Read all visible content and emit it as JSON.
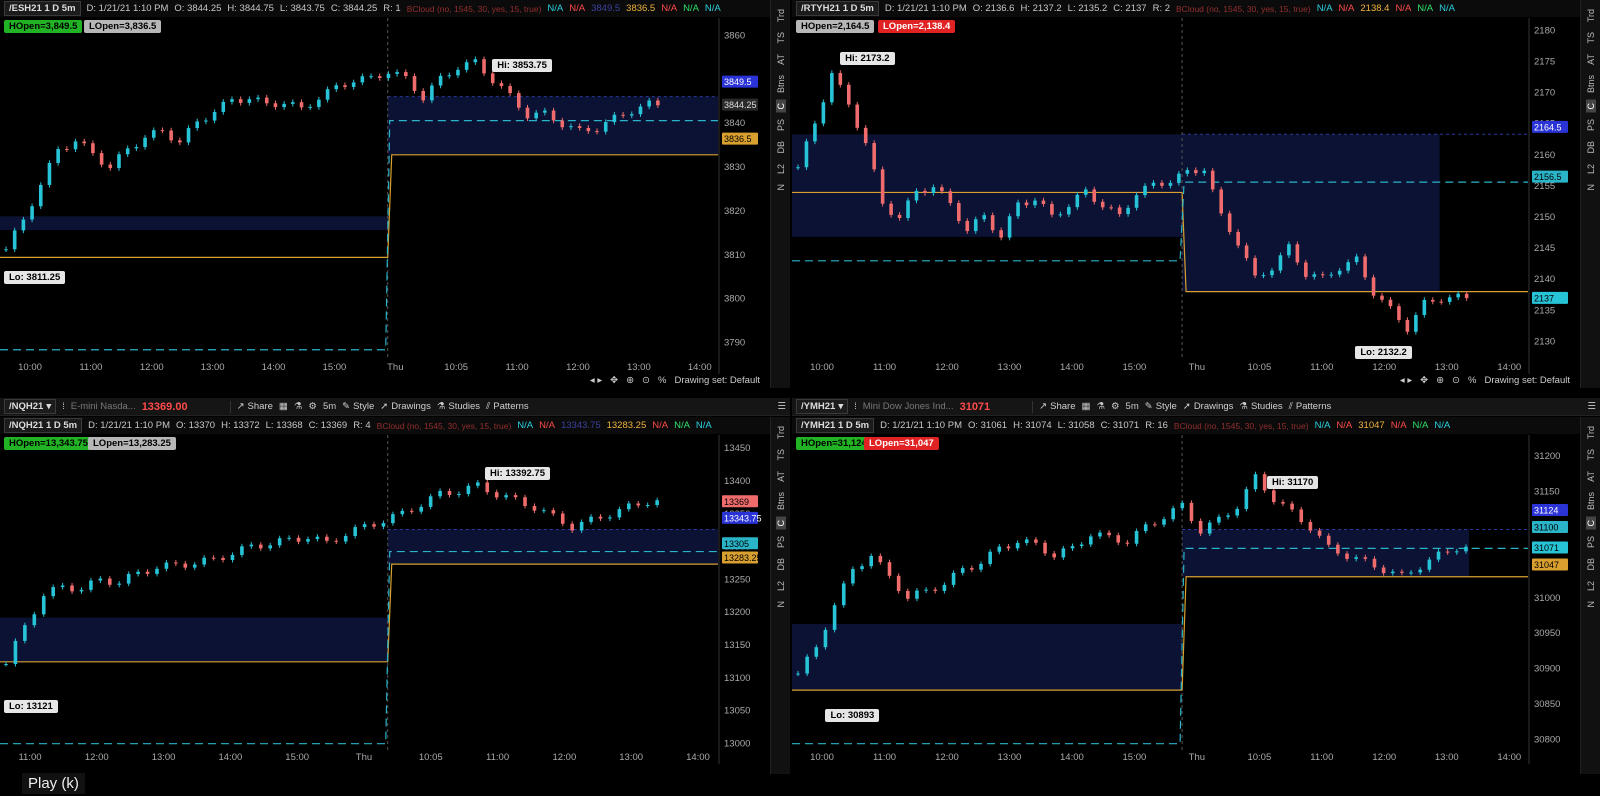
{
  "common": {
    "side_tabs": [
      "Trd",
      "TS",
      "AT",
      "Btns",
      "C",
      "PS",
      "DB",
      "L2",
      "N"
    ],
    "study_label": "BCloud (no, 1545, 30, yes, 15, true)",
    "na": "N/A",
    "interval": "5m",
    "share": "Share",
    "style": "Style",
    "drawings": "Drawings",
    "studies": "Studies",
    "patterns": "Patterns",
    "drawing_set": "Drawing set: Default",
    "play": "Play (k)",
    "colors": {
      "bull": "#27c3d6",
      "bear": "#f06c6c",
      "cloud": "#0b1233",
      "orange": "#d9a030",
      "cyan_dash": "#2ab4c8"
    }
  },
  "panels": [
    {
      "id": "es",
      "symbol": "/ESH21",
      "description": "",
      "last_price": "",
      "change1": "",
      "change2": "",
      "header": {
        "sym": "/ESH21 1 D 5m",
        "date": "D: 1/21/21 1:10 PM",
        "o": "O: 3844.25",
        "h": "H: 3844.75",
        "l": "L: 3843.75",
        "c": "C: 3844.25",
        "r": "R: 1",
        "val1": "3836.5",
        "hidden_val": "3849.5"
      },
      "hopen": "HOpen=3,849.5",
      "lopen": "LOpen=3,836.5",
      "hopen_color": "#22b324",
      "lopen_color": "#b7b7b7",
      "hi_label": "Hi: 3853.75",
      "lo_label": "Lo: 3811.25",
      "chart_data": {
        "type": "line",
        "y_ticks": [
          3860,
          3850,
          3840,
          3830,
          3820,
          3810,
          3800,
          3790
        ],
        "ylim": [
          3786,
          3864
        ],
        "x_ticks": [
          "10:00",
          "11:00",
          "12:00",
          "13:00",
          "14:00",
          "15:00",
          "Thu",
          "10:05",
          "11:00",
          "12:00",
          "13:00",
          "14:00"
        ],
        "series": [
          {
            "values": [
              3811.25,
              3818,
              3826,
              3834,
              3836,
              3833,
              3830,
              3834,
              3837,
              3838,
              3836,
              3840,
              3843,
              3845,
              3846,
              3844,
              3845,
              3843,
              3846,
              3848,
              3850,
              3850,
              3852,
              3850,
              3846,
              3850,
              3853,
              3853.75,
              3850,
              3846,
              3842,
              3842,
              3840,
              3838,
              3839,
              3841,
              3843,
              3844.25
            ]
          }
        ],
        "price_tags": [
          {
            "value": "3849.5",
            "bg": "#2a33d6",
            "fg": "#fff",
            "y": 3849.5
          },
          {
            "value": "3844.25",
            "bg": "#2a2a2a",
            "fg": "#ddd",
            "y": 3844.25
          },
          {
            "value": "3836.5",
            "bg": "#d9a030",
            "fg": "#000",
            "y": 3836.5
          }
        ]
      }
    },
    {
      "id": "rty",
      "symbol": "/RTYH21",
      "description": "",
      "last_price": "",
      "change1": "",
      "change2": "",
      "header": {
        "sym": "/RTYH21 1 D 5m",
        "date": "D: 1/21/21 1:10 PM",
        "o": "O: 2136.6",
        "h": "H: 2137.2",
        "l": "L: 2135.2",
        "c": "C: 2137",
        "r": "R: 2",
        "val1": "2138.4",
        "hidden_val": ""
      },
      "hopen": "HOpen=2,164.5",
      "lopen": "LOpen=2,138.4",
      "hopen_color": "#b7b7b7",
      "lopen_color": "#e02222",
      "hi_label": "Hi: 2173.2",
      "lo_label": "Lo: 2132.2",
      "chart_data": {
        "type": "line",
        "y_ticks": [
          2180,
          2175,
          2170,
          2165,
          2160,
          2155,
          2150,
          2145,
          2140,
          2135,
          2130
        ],
        "ylim": [
          2127,
          2182
        ],
        "x_ticks": [
          "10:00",
          "11:00",
          "12:00",
          "13:00",
          "14:00",
          "15:00",
          "Thu",
          "10:05",
          "11:00",
          "12:00",
          "13:00",
          "14:00"
        ],
        "series": [
          {
            "values": [
              2158,
              2165,
              2173.2,
              2168,
              2162,
              2152,
              2150,
              2154,
              2155,
              2152,
              2148,
              2150,
              2147,
              2152,
              2153,
              2150,
              2152,
              2154,
              2152,
              2150,
              2154,
              2155,
              2156,
              2157,
              2158,
              2150,
              2146,
              2140,
              2142,
              2145,
              2141,
              2140,
              2142,
              2143,
              2138,
              2135,
              2132.2,
              2136,
              2137,
              2137
            ]
          }
        ],
        "price_tags": [
          {
            "value": "2164.5",
            "bg": "#2a33d6",
            "fg": "#fff",
            "y": 2164.5
          },
          {
            "value": "2156.5",
            "bg": "#2ab4c8",
            "fg": "#000",
            "y": 2156.5
          },
          {
            "value": "2137",
            "bg": "#27c3d6",
            "fg": "#000",
            "y": 2137
          }
        ]
      }
    },
    {
      "id": "nq",
      "symbol": "/NQH21",
      "description": "E-mini Nasda...",
      "last_price": "13369.00",
      "change1": "",
      "change2": "",
      "header": {
        "sym": "/NQH21 1 D 5m",
        "date": "D: 1/21/21 1:10 PM",
        "o": "O: 13370",
        "h": "H: 13372",
        "l": "L: 13368",
        "c": "C: 13369",
        "r": "R: 4",
        "val1": "13283.25",
        "hidden_val": "13343.75"
      },
      "hopen": "HOpen=13,343.75",
      "lopen": "LOpen=13,283.25",
      "hopen_color": "#22b324",
      "lopen_color": "#b7b7b7",
      "hi_label": "Hi: 13392.75",
      "lo_label": "Lo: 13121",
      "chart_data": {
        "type": "line",
        "y_ticks": [
          13450,
          13400,
          13350,
          13300,
          13250,
          13200,
          13150,
          13100,
          13050,
          13000
        ],
        "ylim": [
          12990,
          13470
        ],
        "x_ticks": [
          "11:00",
          "12:00",
          "13:00",
          "14:00",
          "15:00",
          "Thu",
          "10:05",
          "11:00",
          "12:00",
          "13:00",
          "14:00"
        ],
        "series": [
          {
            "values": [
              13121,
              13180,
              13225,
              13240,
              13235,
              13250,
              13245,
              13260,
              13268,
              13272,
              13275,
              13280,
              13290,
              13300,
              13305,
              13310,
              13315,
              13305,
              13320,
              13330,
              13340,
              13350,
              13365,
              13380,
              13385,
              13392.75,
              13380,
              13370,
              13360,
              13345,
              13330,
              13340,
              13350,
              13360,
              13369
            ]
          }
        ],
        "price_tags": [
          {
            "value": "13369",
            "bg": "#f06c6c",
            "fg": "#000",
            "y": 13369
          },
          {
            "value": "13343.75",
            "bg": "#2a33d6",
            "fg": "#fff",
            "y": 13343.75
          },
          {
            "value": "13305",
            "bg": "#2ab4c8",
            "fg": "#000",
            "y": 13305
          },
          {
            "value": "13283.25",
            "bg": "#d9a030",
            "fg": "#000",
            "y": 13283.25
          }
        ]
      }
    },
    {
      "id": "ym",
      "symbol": "/YMH21",
      "description": "Mini Dow Jones Ind...",
      "last_price": "31071",
      "change1": "",
      "change2": "",
      "header": {
        "sym": "/YMH21 1 D 5m",
        "date": "D: 1/21/21 1:10 PM",
        "o": "O: 31061",
        "h": "H: 31074",
        "l": "L: 31058",
        "c": "C: 31071",
        "r": "R: 16",
        "val1": "31047",
        "hidden_val": ""
      },
      "hopen": "HOpen=31,124",
      "lopen": "LOpen=31,047",
      "hopen_color": "#22b324",
      "lopen_color": "#e02222",
      "hi_label": "Hi: 31170",
      "lo_label": "Lo: 30893",
      "chart_data": {
        "type": "line",
        "y_ticks": [
          31200,
          31150,
          31100,
          31050,
          31000,
          30950,
          30900,
          30850,
          30800
        ],
        "ylim": [
          30785,
          31230
        ],
        "x_ticks": [
          "10:00",
          "11:00",
          "12:00",
          "13:00",
          "14:00",
          "15:00",
          "Thu",
          "10:05",
          "11:00",
          "12:00",
          "13:00",
          "14:00"
        ],
        "series": [
          {
            "values": [
              30893,
              30930,
              30990,
              31040,
              31060,
              31030,
              31000,
              31010,
              31020,
              31040,
              31050,
              31070,
              31080,
              31075,
              31060,
              31070,
              31090,
              31085,
              31080,
              31100,
              31115,
              31130,
              31095,
              31110,
              31130,
              31170,
              31140,
              31120,
              31100,
              31070,
              31060,
              31050,
              31040,
              31030,
              31045,
              31060,
              31071
            ]
          }
        ],
        "price_tags": [
          {
            "value": "31124",
            "bg": "#2a33d6",
            "fg": "#fff",
            "y": 31124
          },
          {
            "value": "31100",
            "bg": "#2ab4c8",
            "fg": "#000",
            "y": 31100
          },
          {
            "value": "31071",
            "bg": "#27c3d6",
            "fg": "#000",
            "y": 31071
          },
          {
            "value": "31047",
            "bg": "#d9a030",
            "fg": "#000",
            "y": 31047
          }
        ]
      }
    }
  ]
}
